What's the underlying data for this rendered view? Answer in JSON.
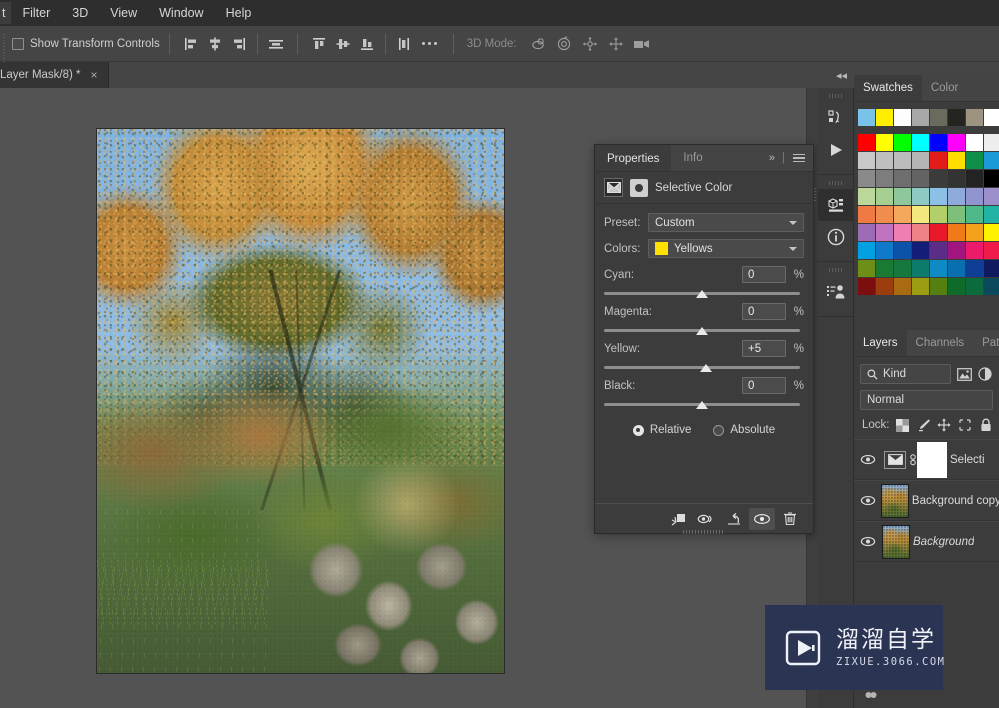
{
  "app": {
    "name": "Adobe Photoshop"
  },
  "menubar": {
    "items": [
      {
        "label": "t",
        "name": "menu-edit-truncated"
      },
      {
        "label": "Filter",
        "name": "menu-filter"
      },
      {
        "label": "3D",
        "name": "menu-3d"
      },
      {
        "label": "View",
        "name": "menu-view"
      },
      {
        "label": "Window",
        "name": "menu-window"
      },
      {
        "label": "Help",
        "name": "menu-help"
      }
    ]
  },
  "optionsbar": {
    "show_transform_controls": "Show Transform Controls",
    "mode_label": "3D Mode:",
    "align_buttons": [
      "align-left-edges",
      "align-horizontal-centers",
      "align-right-edges",
      "align-horizontal-distribute",
      "align-top-edges",
      "align-vertical-centers",
      "align-bottom-edges",
      "distribute-vertical"
    ],
    "more_label": "more-options",
    "mode_buttons": [
      "3d-orbit",
      "3d-roll",
      "3d-pan",
      "3d-slide",
      "3d-camera"
    ]
  },
  "document": {
    "tab_title": "Layer Mask/8) *",
    "close_label": "×"
  },
  "properties": {
    "tabs": [
      {
        "label": "Properties",
        "active": true
      },
      {
        "label": "Info",
        "active": false
      }
    ],
    "adjustment_name": "Selective Color",
    "preset_label": "Preset:",
    "preset_value": "Custom",
    "colors_label": "Colors:",
    "colors_value": "Yellows",
    "colors_swatch": "#ffe000",
    "sliders": [
      {
        "label": "Cyan:",
        "value": "0",
        "unit": "%",
        "pos": 50
      },
      {
        "label": "Magenta:",
        "value": "0",
        "unit": "%",
        "pos": 50
      },
      {
        "label": "Yellow:",
        "value": "+5",
        "unit": "%",
        "pos": 52
      },
      {
        "label": "Black:",
        "value": "0",
        "unit": "%",
        "pos": 50
      }
    ],
    "method": {
      "relative": "Relative",
      "absolute": "Absolute",
      "selected": "Relative"
    },
    "footer_buttons": [
      "clip-to-layer-icon",
      "view-previous-state-icon",
      "reset-icon",
      "toggle-visibility-icon",
      "delete-icon"
    ]
  },
  "iconrail": {
    "collapse_label": "◂◂",
    "buttons": [
      "history-icon",
      "actions-play-icon",
      "3d-properties-icon",
      "info-icon",
      "notes-clone-source-icon"
    ]
  },
  "swatches": {
    "tabs": [
      {
        "label": "Swatches",
        "active": true
      },
      {
        "label": "Color",
        "active": false
      }
    ],
    "recent_row": [
      "#79c3ea",
      "#ffee00",
      "#fdfdfd",
      "#a8a8a8",
      "#6b6b5d",
      "#242421",
      "#9c9480",
      "#ffffff"
    ],
    "grid": [
      [
        "#ff0000",
        "#ffff00",
        "#00ff00",
        "#00ffff",
        "#0000ff",
        "#ff00ff",
        "#ffffff",
        "#ededed"
      ],
      [
        "#c8c8c8",
        "#bfbfbf",
        "#bcbcbc",
        "#b4b4b4",
        "#e21b1b",
        "#ffdd00",
        "#0f8f4a",
        "#1a9bd7"
      ],
      [
        "#8a8a8a",
        "#7d7d7d",
        "#6e6e6e",
        "#636363",
        "#3b3b3b",
        "#333333",
        "#232323",
        "#000000"
      ],
      [
        "#bcd79a",
        "#a8cf93",
        "#8fc79c",
        "#8fc9c4",
        "#8dc0e6",
        "#8fabdb",
        "#9095cf",
        "#9c8fcb"
      ],
      [
        "#ef7a45",
        "#f08c4e",
        "#f4a85c",
        "#f2e87e",
        "#b2cf6a",
        "#7ec07a",
        "#4fb98a",
        "#22b2a6"
      ],
      [
        "#9c6bb5",
        "#c074c0",
        "#ef7fb2",
        "#ef8287",
        "#e8192a",
        "#f07a18",
        "#f4a11c",
        "#fff200"
      ],
      [
        "#00a0e3",
        "#0e7ac9",
        "#0b52a8",
        "#141e78",
        "#5b2d86",
        "#a1167e",
        "#ec1a6b",
        "#ef1b48"
      ],
      [
        "#6d8f17",
        "#1a7a33",
        "#16783c",
        "#0e7a6b",
        "#0e8bc4",
        "#0a6fae",
        "#0e3f94",
        "#101a5e"
      ],
      [
        "#7d0e10",
        "#9c3d10",
        "#a86b12",
        "#9c9c12",
        "#567f12",
        "#0e6b2a",
        "#0c6b3c",
        "#0b4a5c"
      ]
    ]
  },
  "layers": {
    "tabs": [
      {
        "label": "Layers",
        "active": true
      },
      {
        "label": "Channels",
        "active": false
      },
      {
        "label": "Paths",
        "active": false
      }
    ],
    "filter_value": "Kind",
    "filter_icons": [
      "pixel-filter-icon",
      "adjustment-filter-icon"
    ],
    "blend_mode": "Normal",
    "lock_label": "Lock:",
    "lock_icons": [
      "lock-transparent-pixels-icon",
      "lock-image-pixels-icon",
      "lock-position-icon",
      "lock-artboard-icon",
      "lock-all-icon"
    ],
    "rows": [
      {
        "name": "Selecti",
        "type": "adjustment",
        "visible": true,
        "italic": false
      },
      {
        "name": "Background copy",
        "type": "pixel",
        "visible": true,
        "italic": false
      },
      {
        "name": "Background",
        "type": "pixel",
        "visible": true,
        "italic": true
      }
    ]
  },
  "watermark": {
    "cn": "溜溜自学",
    "en": "ZIXUE.3066.COM",
    "bg": "#2b3553"
  }
}
